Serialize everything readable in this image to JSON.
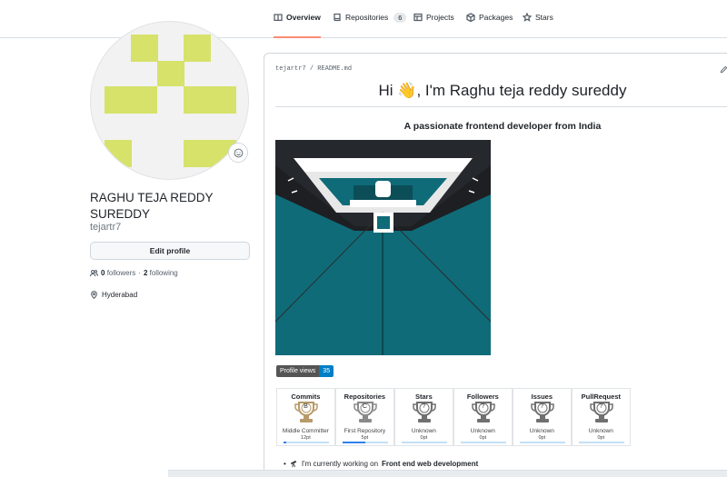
{
  "nav": {
    "tabs": [
      {
        "label": "Overview",
        "icon": "book-icon",
        "active": true
      },
      {
        "label": "Repositories",
        "icon": "repo-icon",
        "count": "6"
      },
      {
        "label": "Projects",
        "icon": "table-icon"
      },
      {
        "label": "Packages",
        "icon": "package-icon"
      },
      {
        "label": "Stars",
        "icon": "star-icon"
      }
    ]
  },
  "profile": {
    "full_name": "RAGHU TEJA REDDY SUREDDY",
    "login": "tejartr7",
    "edit_label": "Edit profile",
    "followers_count": "0",
    "followers_label": "followers",
    "separator": "·",
    "following_count": "2",
    "following_label": "following",
    "location": "Hyderabad",
    "avatar_color": "#d6e26a"
  },
  "readme": {
    "path_user": "tejartr7",
    "path_sep": "/",
    "path_file": "README.md",
    "title": "Hi 👋, I'm Raghu teja reddy sureddy",
    "subtitle": "A passionate frontend developer from India",
    "profile_views_label": "Profile views",
    "profile_views_value": "35",
    "bullet_prefix": "I'm currently working on",
    "bullet_bold": "Front end web development"
  },
  "trophies": [
    {
      "title": "Commits",
      "rank": "B",
      "label": "Middle Committer",
      "points": "12pt",
      "progress": 0.05,
      "color": "#b79a6a"
    },
    {
      "title": "Repositories",
      "rank": "C",
      "label": "First Repository",
      "points": "5pt",
      "progress": 0.5,
      "color": "#8a8a8a"
    },
    {
      "title": "Stars",
      "rank": "?",
      "label": "Unknown",
      "points": "0pt",
      "progress": 0,
      "color": "#707070"
    },
    {
      "title": "Followers",
      "rank": "?",
      "label": "Unknown",
      "points": "0pt",
      "progress": 0,
      "color": "#707070"
    },
    {
      "title": "Issues",
      "rank": "?",
      "label": "Unknown",
      "points": "0pt",
      "progress": 0,
      "color": "#707070"
    },
    {
      "title": "PullRequest",
      "rank": "?",
      "label": "Unknown",
      "points": "0pt",
      "progress": 0,
      "color": "#707070"
    }
  ],
  "colors": {
    "accent_tab": "#fd8c73",
    "badge_blue": "#007ec6",
    "hero_teal": "#0f6b78"
  }
}
